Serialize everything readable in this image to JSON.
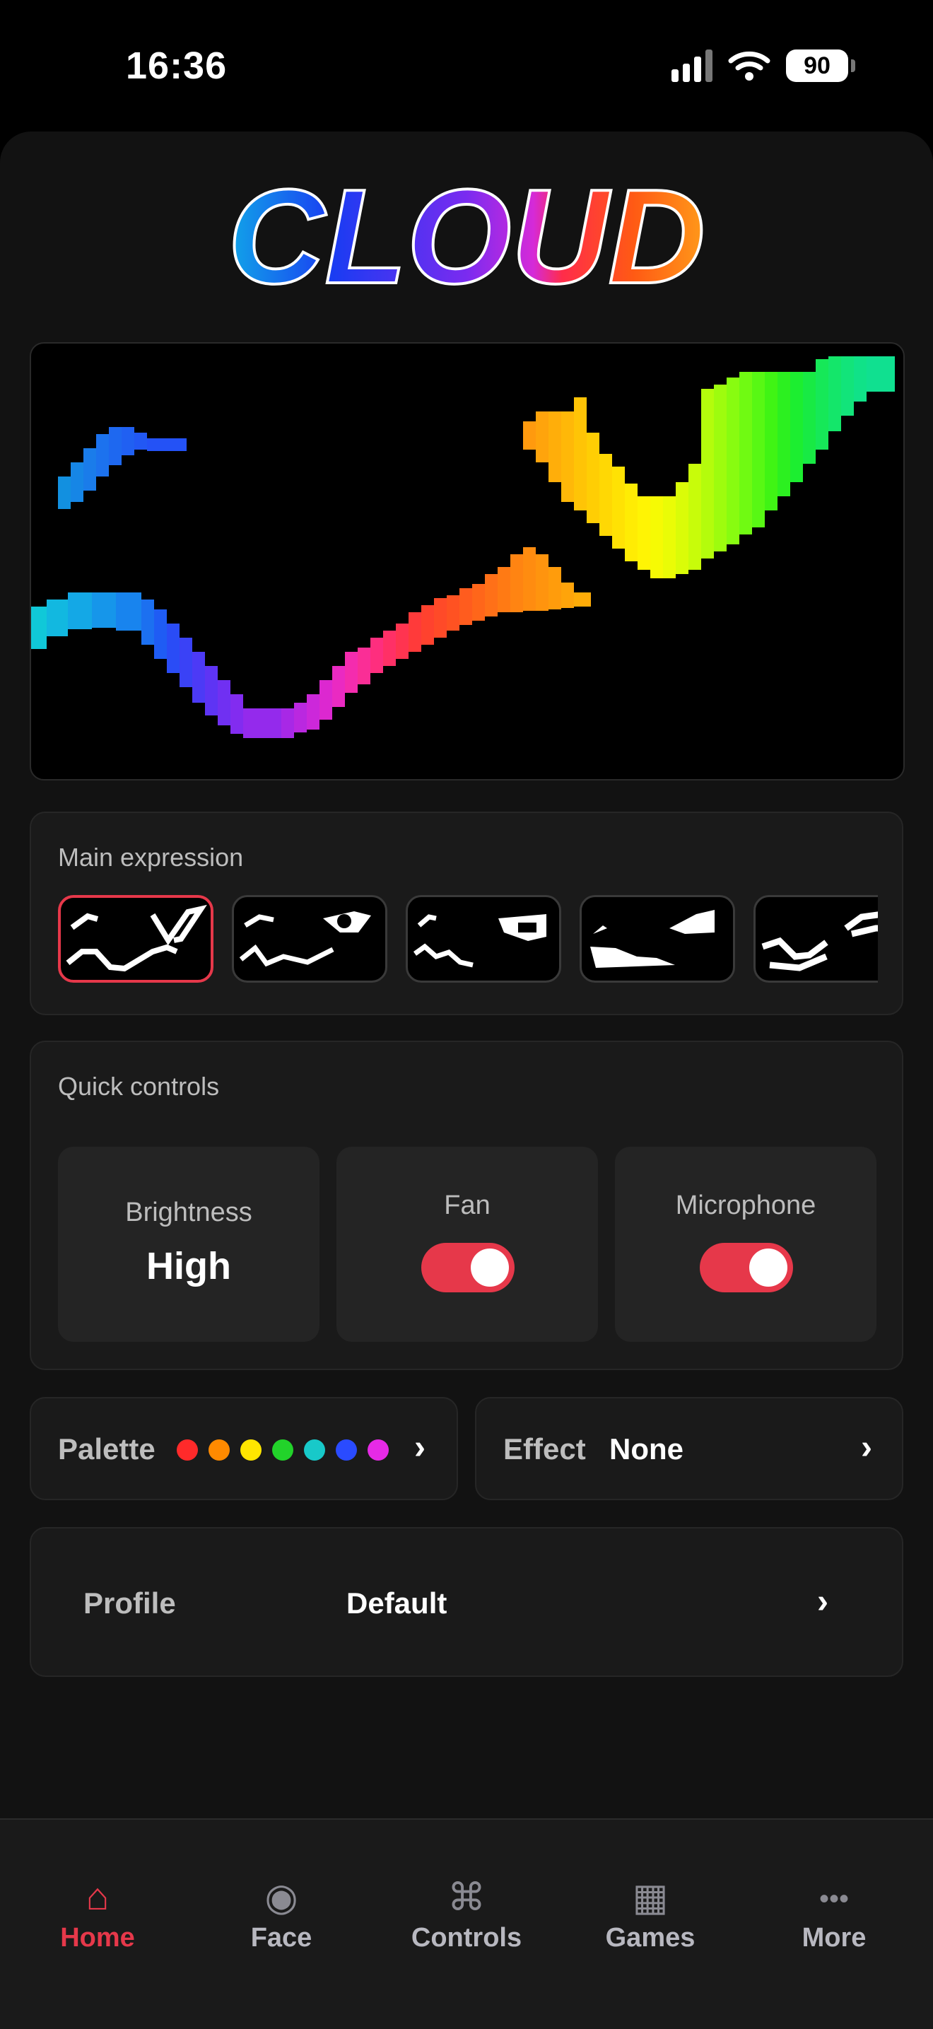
{
  "status_bar": {
    "time": "16:36",
    "battery": "90"
  },
  "app": {
    "logo_text": "CLOUD"
  },
  "main_expression": {
    "title": "Main expression",
    "selected_index": 0
  },
  "quick_controls": {
    "title": "Quick controls",
    "brightness": {
      "label": "Brightness",
      "value": "High"
    },
    "fan": {
      "label": "Fan",
      "on": true
    },
    "microphone": {
      "label": "Microphone",
      "on": true
    }
  },
  "palette": {
    "label": "Palette",
    "colors": [
      "#ff2a2a",
      "#ff8a00",
      "#ffe600",
      "#22d32a",
      "#18c9c9",
      "#2a4bff",
      "#e62ae6"
    ]
  },
  "effect": {
    "label": "Effect",
    "value": "None"
  },
  "profile": {
    "label": "Profile",
    "value": "Default"
  },
  "tabs": [
    {
      "label": "Home",
      "icon": "home-icon",
      "glyph": "⌂",
      "active": true
    },
    {
      "label": "Face",
      "icon": "face-icon",
      "glyph": "◉",
      "active": false
    },
    {
      "label": "Controls",
      "icon": "command-icon",
      "glyph": "⌘",
      "active": false
    },
    {
      "label": "Games",
      "icon": "grid-icon",
      "glyph": "▦",
      "active": false
    },
    {
      "label": "More",
      "icon": "more-icon",
      "glyph": "•••",
      "active": false
    }
  ],
  "colors": {
    "accent": "#e6384a",
    "panel": "#121212",
    "card": "#1a1a1a"
  }
}
